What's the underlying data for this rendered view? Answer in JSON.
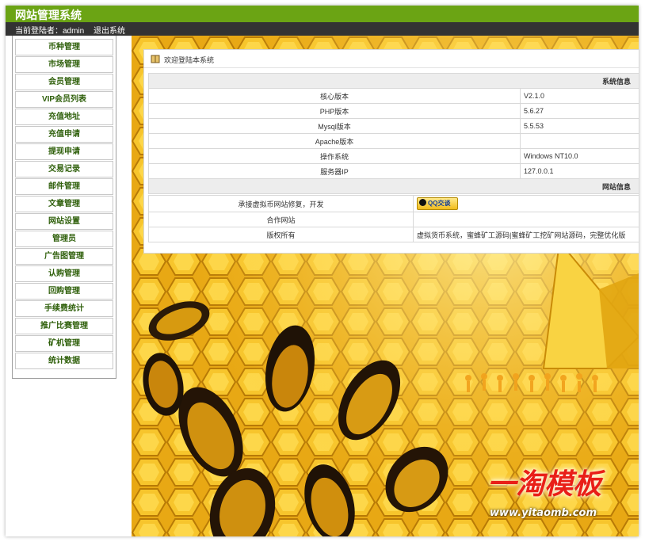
{
  "header": {
    "site_title": "网站管理系统",
    "user_label": "当前登陆者：admin",
    "logout_label": "退出系统"
  },
  "sidebar": {
    "items": [
      {
        "label": "币种管理"
      },
      {
        "label": "市场管理"
      },
      {
        "label": "会员管理"
      },
      {
        "label": "VIP会员列表"
      },
      {
        "label": "充值地址"
      },
      {
        "label": "充值申请"
      },
      {
        "label": "提现申请"
      },
      {
        "label": "交易记录"
      },
      {
        "label": "邮件管理"
      },
      {
        "label": "文章管理"
      },
      {
        "label": "网站设置"
      },
      {
        "label": "管理员"
      },
      {
        "label": "广告图管理"
      },
      {
        "label": "认购管理"
      },
      {
        "label": "回购管理"
      },
      {
        "label": "手续费统计"
      },
      {
        "label": "推广比赛管理"
      },
      {
        "label": "矿机管理"
      },
      {
        "label": "统计数据"
      }
    ]
  },
  "main": {
    "panel_title": "欢迎登陆本系统",
    "system_info": {
      "heading": "系统信息",
      "rows": [
        {
          "key": "核心版本",
          "value": "V2.1.0"
        },
        {
          "key": "PHP版本",
          "value": "5.6.27"
        },
        {
          "key": "Mysql版本",
          "value": "5.5.53"
        },
        {
          "key": "Apache版本",
          "value": ""
        },
        {
          "key": "操作系统",
          "value": "Windows NT10.0"
        },
        {
          "key": "服务器IP",
          "value": "127.0.0.1"
        }
      ]
    },
    "site_info": {
      "heading": "网站信息",
      "contact_label": "承接虚拟币网站修复，开发",
      "qq_button": "QQ交谈",
      "partner_label": "合作网站",
      "partner_value": "",
      "copyright_label": "版权所有",
      "copyright_value": "虚拟货币系统，蜜蜂矿工源码|蜜蜂矿工挖矿网站源码，完整优化版"
    }
  },
  "watermark": {
    "brand": "一淘模板",
    "url": "www.yitaomb.com"
  },
  "colors": {
    "top_bar": "#6ba414",
    "user_bar": "#333333",
    "menu_text": "#2e5f0a",
    "honey": "#e8a814"
  }
}
